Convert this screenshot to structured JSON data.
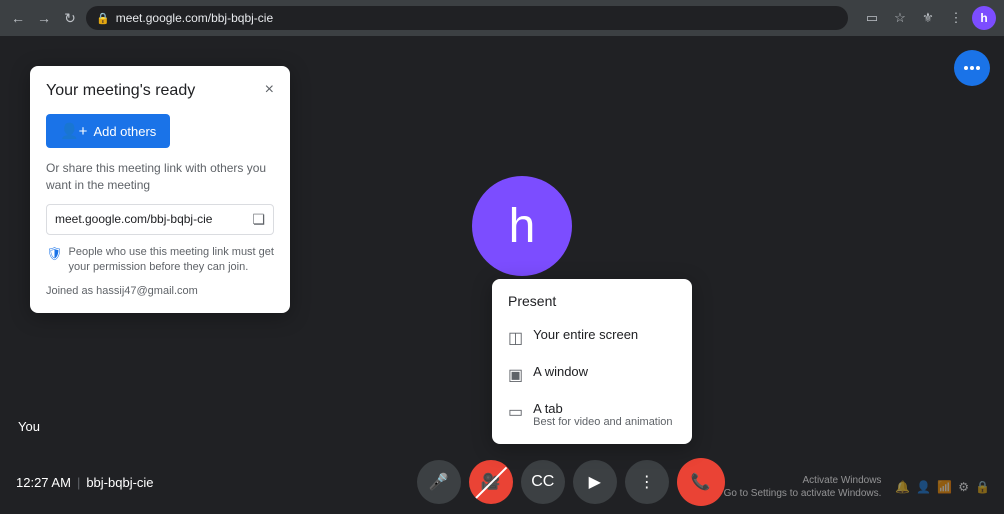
{
  "browser": {
    "url": "meet.google.com/bbj-bqbj-cie",
    "profile_initial": "h"
  },
  "card": {
    "title": "Your meeting's ready",
    "close_label": "×",
    "add_others_label": "Add others",
    "share_text": "Or share this meeting link with others you want in the meeting",
    "meeting_link": "meet.google.com/bbj-bqbj-cie",
    "security_text": "People who use this meeting link must get your permission before they can join.",
    "joined_as": "Joined as hassij47@gmail.com"
  },
  "user": {
    "avatar_initial": "h",
    "you_label": "You"
  },
  "present_menu": {
    "title": "Present",
    "options": [
      {
        "label": "Your entire screen",
        "sub": ""
      },
      {
        "label": "A window",
        "sub": ""
      },
      {
        "label": "A tab",
        "sub": "Best for video and animation"
      }
    ]
  },
  "bottom_bar": {
    "time": "12:27 AM",
    "divider": "|",
    "meeting_code": "bbj-bqbj-cie"
  },
  "windows_notice": {
    "line1": "Activate Windows",
    "line2": "Go to Settings to activate Windows."
  }
}
